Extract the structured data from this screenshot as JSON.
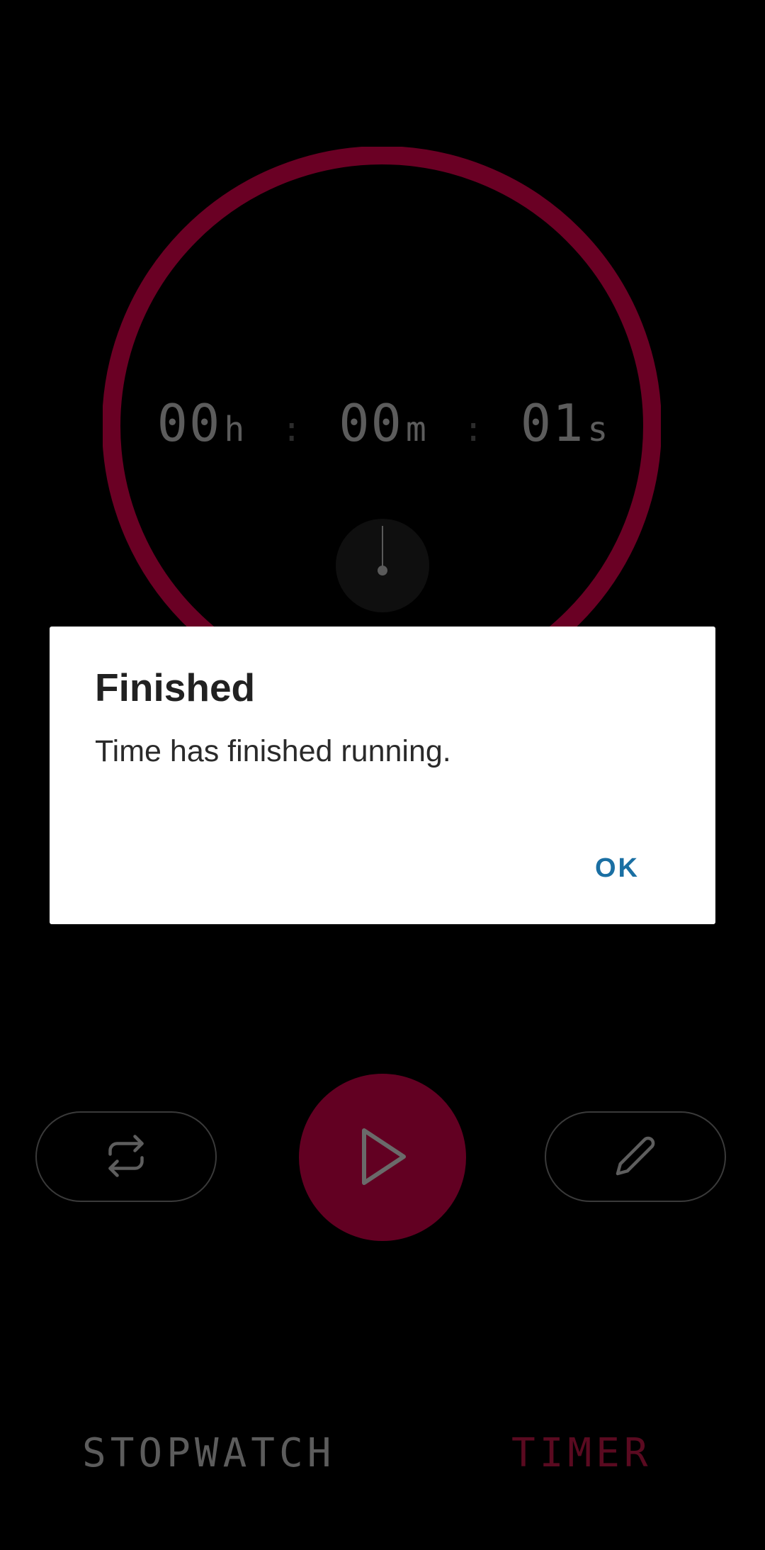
{
  "timer": {
    "hours": "00",
    "hours_unit": "h",
    "minutes": "00",
    "minutes_unit": "m",
    "seconds": "01",
    "seconds_unit": "s",
    "separator": ":"
  },
  "controls": {
    "reset_icon": "repeat-icon",
    "play_icon": "play-icon",
    "edit_icon": "pencil-icon"
  },
  "tabs": [
    {
      "label": "STOPWATCH",
      "active": false
    },
    {
      "label": "TIMER",
      "active": true
    }
  ],
  "dialog": {
    "title": "Finished",
    "message": "Time has finished running.",
    "ok_label": "OK"
  },
  "colors": {
    "accent": "#620022",
    "ring": "#6a0024",
    "dialog_button": "#1a6fa3",
    "background": "#000000"
  }
}
